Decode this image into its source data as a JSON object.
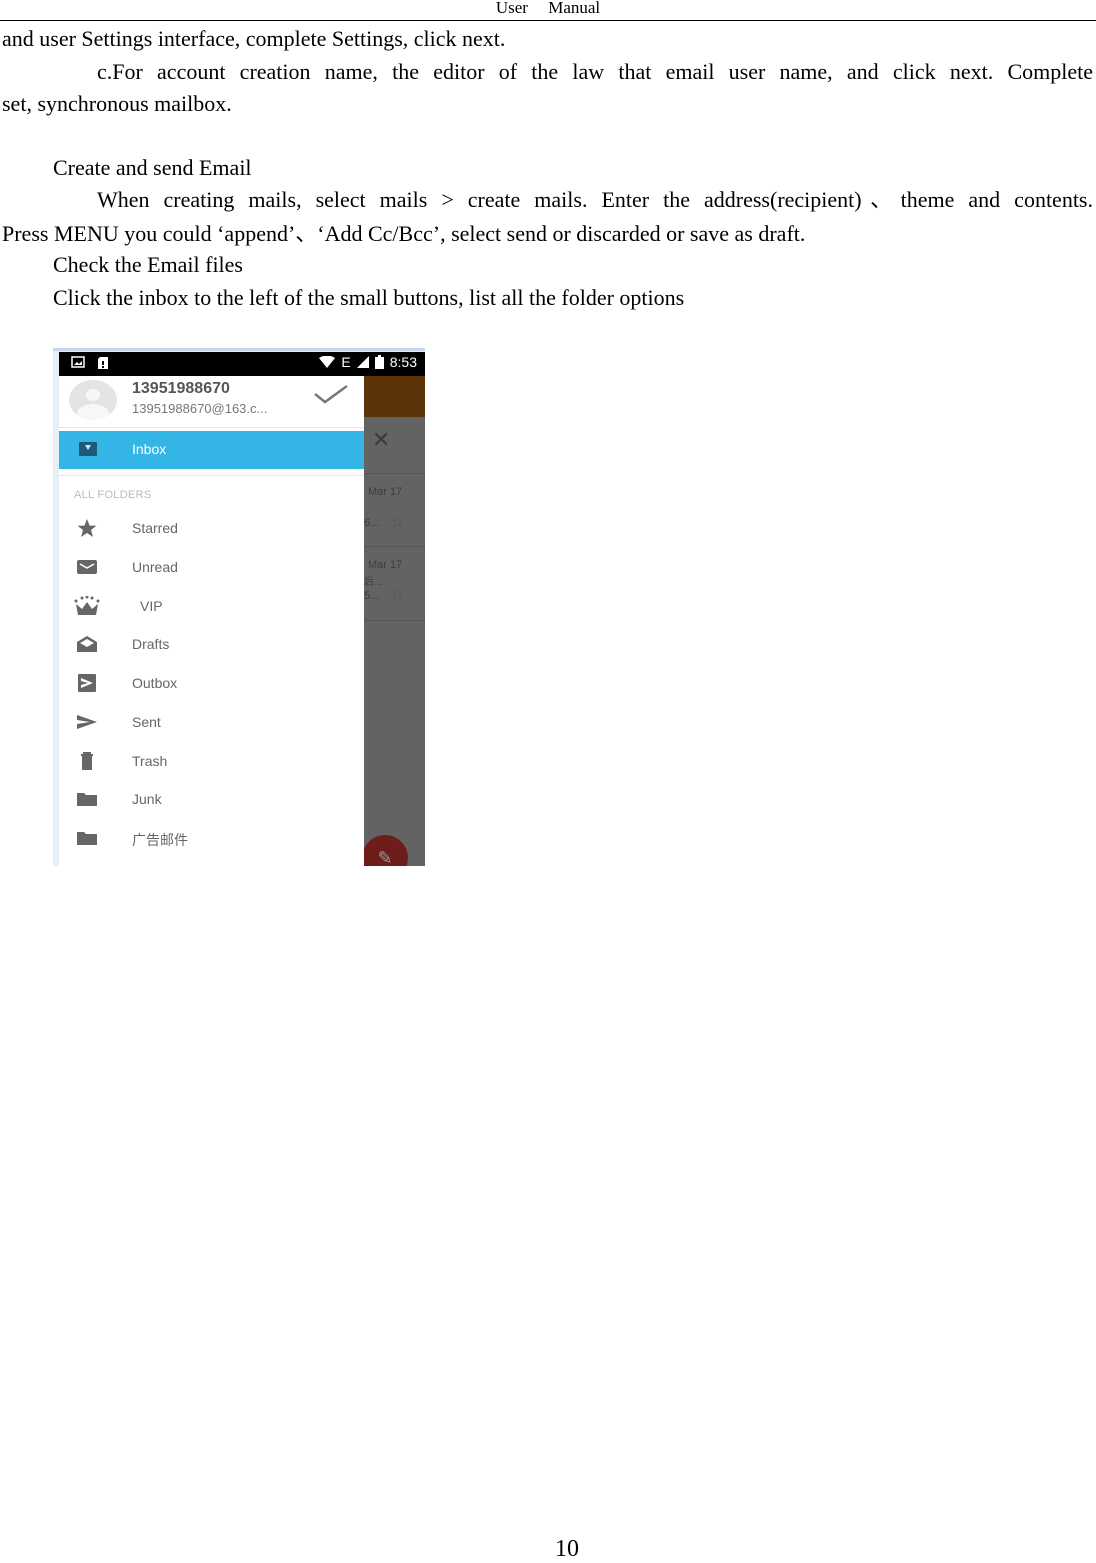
{
  "header": {
    "left": "User",
    "right": "Manual"
  },
  "body": {
    "line1": "and user Settings interface, complete Settings, click next.",
    "line2": "c.For account creation name, the editor of the law that email user name, and click next. Complete",
    "line3": "set, synchronous mailbox.",
    "heading_create": "Create and send Email",
    "line4": "When creating mails, select mails > create mails. Enter the address(recipient)、theme and contents.",
    "line5": "Press MENU you could ‘append’、‘Add Cc/Bcc’,    select send or discarded or save as draft.",
    "heading_check": "Check the Email files",
    "line6": "Click the inbox to the left of the small buttons, list all the folder options"
  },
  "phone": {
    "status_bar": {
      "network": "E",
      "time": "8:53"
    },
    "account": {
      "name": "13951988670",
      "email": "13951988670@163.c..."
    },
    "inbox_label": "Inbox",
    "section_label": "ALL FOLDERS",
    "folders": [
      {
        "label": "Starred",
        "icon": "star-icon"
      },
      {
        "label": "Unread",
        "icon": "envelope-icon"
      },
      {
        "label": "VIP",
        "icon": "crown-icon"
      },
      {
        "label": "Drafts",
        "icon": "drafts-icon"
      },
      {
        "label": "Outbox",
        "icon": "outbox-icon"
      },
      {
        "label": "Sent",
        "icon": "send-icon"
      },
      {
        "label": "Trash",
        "icon": "trash-icon"
      },
      {
        "label": "Junk",
        "icon": "folder-icon"
      },
      {
        "label": "广告邮件",
        "icon": "folder-icon"
      }
    ],
    "background_list": [
      {
        "date": "Mar 17",
        "snippet": "6..."
      },
      {
        "date": "Mar 17",
        "snippet": "5...",
        "extra": "后..."
      }
    ],
    "colors": {
      "inbox_highlight": "#33b5e5",
      "app_bar": "#5d3309",
      "fab": "#6e1e1a"
    }
  },
  "footer": {
    "page_number": "10"
  }
}
